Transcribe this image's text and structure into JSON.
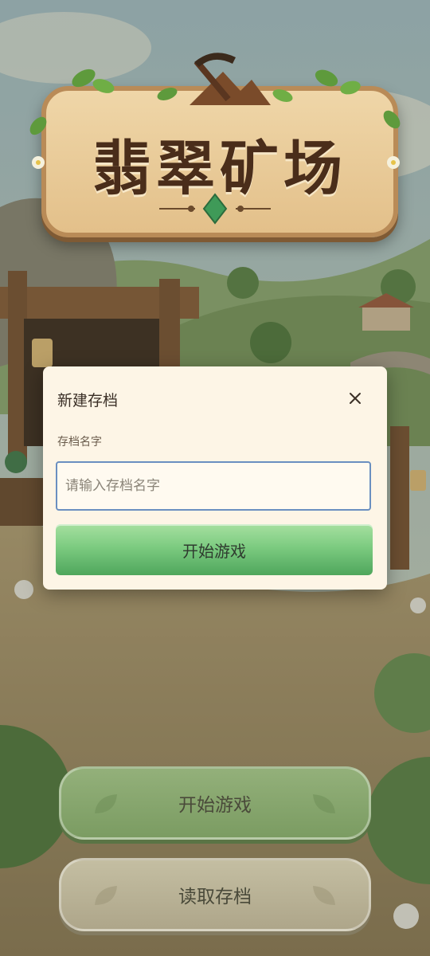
{
  "game": {
    "title": "翡翠矿场"
  },
  "dialog": {
    "title": "新建存档",
    "field_label": "存档名字",
    "input_value": "",
    "input_placeholder": "请输入存档名字",
    "confirm_label": "开始游戏"
  },
  "menu": {
    "start_label": "开始游戏",
    "load_label": "读取存档"
  },
  "colors": {
    "confirm_green": "#7ccb80",
    "dialog_bg": "#fdf5e6",
    "input_border": "#6a8fc0",
    "start_button": "#8aa870",
    "load_button": "#bab496"
  },
  "icons": [
    "pickaxe-icon",
    "mountain-icon",
    "emerald-gem-icon",
    "close-icon",
    "leaf-icon"
  ]
}
